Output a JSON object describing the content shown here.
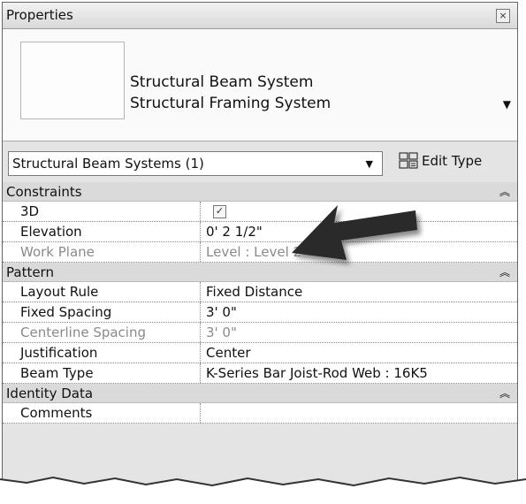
{
  "panel": {
    "title": "Properties",
    "close_icon": "close-icon"
  },
  "type_selector": {
    "family": "Structural Beam System",
    "type": "Structural Framing System"
  },
  "instance_filter": {
    "selected": "Structural Beam Systems (1)",
    "edit_type_label": "Edit Type"
  },
  "groups": {
    "constraints": "Constraints",
    "pattern": "Pattern",
    "identity": "Identity Data"
  },
  "rows": {
    "r3d": {
      "name": "3D",
      "checked": true,
      "check_glyph": "✓"
    },
    "elevation": {
      "name": "Elevation",
      "value": "0'  2 1/2\""
    },
    "work_plane": {
      "name": "Work Plane",
      "value": "Level : Level 2"
    },
    "layout_rule": {
      "name": "Layout Rule",
      "value": "Fixed Distance"
    },
    "fixed_spacing": {
      "name": "Fixed Spacing",
      "value": "3'  0\""
    },
    "centerline_spacing": {
      "name": "Centerline Spacing",
      "value": "3'  0\""
    },
    "justification": {
      "name": "Justification",
      "value": "Center"
    },
    "beam_type": {
      "name": "Beam Type",
      "value": "K-Series Bar Joist-Rod Web : 16K5"
    },
    "comments": {
      "name": "Comments",
      "value": ""
    }
  },
  "glyphs": {
    "collapse": "«",
    "dropdown": "▼"
  },
  "colors": {
    "panel_bg": "#e4e4e4",
    "group_bg": "#dadada",
    "arrow": "#2a2a2a"
  }
}
